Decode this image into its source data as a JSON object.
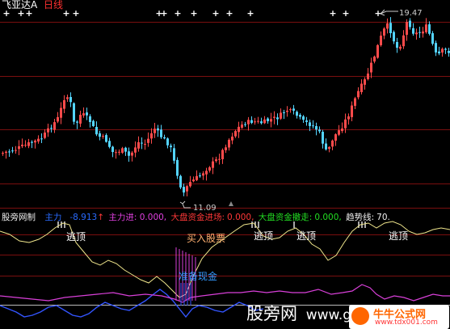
{
  "colors": {
    "background": "#000000",
    "up_candle": "#ff4b4b",
    "down_candle": "#54d4ff",
    "grid": "#7a0f0f",
    "white_line": "#f2f2f2",
    "yellow_line": "#f0e68c",
    "blue_line": "#3355ff",
    "magenta_line": "#d940d9",
    "title_white": "#ffffff",
    "title_red": "#ff3030",
    "lbl_blue": "#2a6bff",
    "lbl_magenta": "#e040e0",
    "lbl_red": "#ff3838",
    "lbl_green": "#22dd22",
    "lbl_white": "#f0f0f0",
    "flee_text": "#ffffff",
    "buy_text": "#ffb070",
    "prepare_text": "#3399ff",
    "watermark": "#ffffff",
    "logo_orange": "#ff6600",
    "logo_site": "#ff3333"
  },
  "header": {
    "stock_name": "飞亚达A",
    "period": "日线"
  },
  "price_panel": {
    "high_label": "19.47",
    "low_label": "11.09",
    "plus_marks": 13
  },
  "indicator_panel": {
    "name": "股旁网制",
    "main_force_label": "主力",
    "main_force_value": "-8.913",
    "main_in_label": "主力进:",
    "main_in_value": "0.000,",
    "market_in_label": "大盘资金进场:",
    "market_in_value": "0.000,",
    "market_out_label": "大盘资金撤走:",
    "market_out_value": "0.000,",
    "trend_label": "趋势线:",
    "trend_value": "70.",
    "flee_labels": [
      "逃顶",
      "逃顶",
      "逃顶",
      "逃顶"
    ],
    "buy_label": "买入股票",
    "prepare_label": "准备现金"
  },
  "watermarks": {
    "site_cn": "股旁网",
    "site_url_partial": "www.g",
    "logo_cn": "牛牛公式网",
    "logo_url": "www.tdx001.com"
  }
}
